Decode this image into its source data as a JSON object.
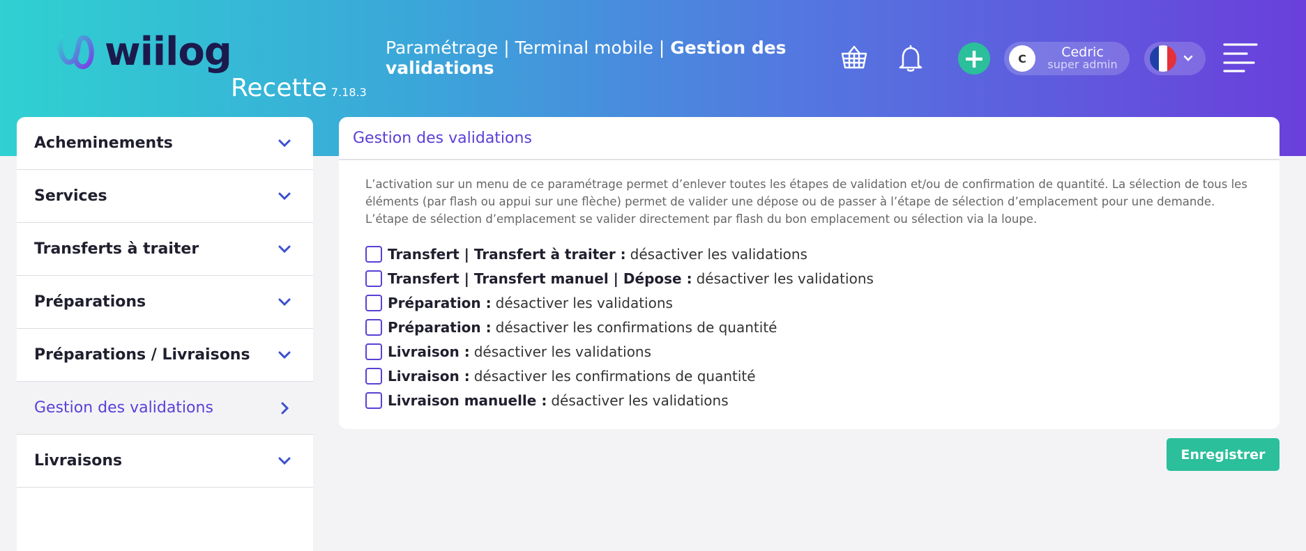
{
  "header": {
    "logo_text": "wiilog",
    "environment": "Recette",
    "version": "7.18.3",
    "breadcrumb_prefix": "Paramétrage | Terminal mobile | ",
    "breadcrumb_current": "Gestion des validations",
    "user": {
      "initial": "C",
      "name": "Cedric",
      "role": "super admin"
    },
    "icons": [
      "basket-icon",
      "bell-icon",
      "plus-icon",
      "flag-fr-icon",
      "chevron-down-icon",
      "menu-icon"
    ]
  },
  "sidebar": {
    "items": [
      {
        "label": "Acheminements",
        "active": false
      },
      {
        "label": "Services",
        "active": false
      },
      {
        "label": "Transferts à traiter",
        "active": false
      },
      {
        "label": "Préparations",
        "active": false
      },
      {
        "label": "Préparations / Livraisons",
        "active": false
      },
      {
        "label": "Gestion des validations",
        "active": true
      },
      {
        "label": "Livraisons",
        "active": false
      }
    ]
  },
  "main": {
    "title": "Gestion des validations",
    "description": "L’activation sur un menu de ce paramétrage permet d’enlever toutes les étapes de validation et/ou de confirmation de quantité. La sélection de tous les éléments (par flash ou appui sur une flèche) permet de valider une dépose ou de passer à l’étape de sélection d’emplacement pour une demande. L’étape de sélection d’emplacement se valider directement par flash du bon emplacement ou sélection via la loupe.",
    "options": [
      {
        "bold": "Transfert | Transfert à traiter :",
        "rest": "désactiver les validations",
        "checked": false
      },
      {
        "bold": "Transfert | Transfert manuel | Dépose :",
        "rest": "désactiver les validations",
        "checked": false
      },
      {
        "bold": "Préparation :",
        "rest": "désactiver les validations",
        "checked": false
      },
      {
        "bold": "Préparation :",
        "rest": "désactiver les confirmations de quantité",
        "checked": false
      },
      {
        "bold": "Livraison :",
        "rest": "désactiver les validations",
        "checked": false
      },
      {
        "bold": "Livraison :",
        "rest": "désactiver les confirmations de quantité",
        "checked": false
      },
      {
        "bold": "Livraison manuelle :",
        "rest": "désactiver les validations",
        "checked": false
      }
    ],
    "save_label": "Enregistrer"
  },
  "colors": {
    "accent": "#5b3fd6",
    "success": "#2bbf9b",
    "gradient_start": "#2fd1d1",
    "gradient_end": "#6a3fdb"
  }
}
